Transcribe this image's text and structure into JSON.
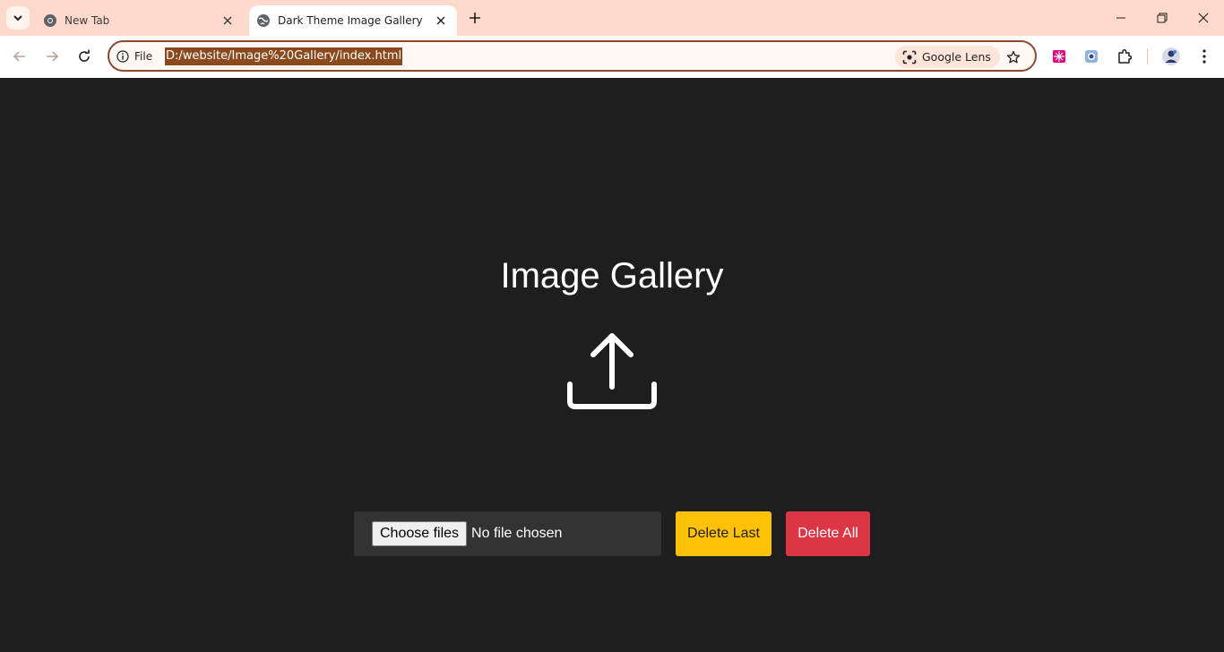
{
  "browser": {
    "tabs": [
      {
        "title": "New Tab",
        "favicon": "chrome-icon",
        "active": false
      },
      {
        "title": "Dark Theme Image Gallery",
        "favicon": "globe-icon",
        "active": true
      }
    ],
    "address_bar": {
      "scheme_label": "File",
      "url": "D:/website/Image%20Gallery/index.html",
      "lens_label": "Google Lens"
    },
    "colors": {
      "tabstrip": "#ffd9cc",
      "omnibox_border": "#8a4a2e",
      "url_highlight": "#8a4a1e"
    }
  },
  "page": {
    "title": "Image Gallery",
    "upload_icon": "upload-icon",
    "file_input": {
      "button_label": "Choose files",
      "status": "No file chosen"
    },
    "buttons": {
      "delete_last": "Delete Last",
      "delete_all": "Delete All"
    },
    "colors": {
      "background": "#1e1e1e",
      "file_box": "#333333",
      "delete_last": "#ffc107",
      "delete_all": "#dc3545"
    }
  }
}
